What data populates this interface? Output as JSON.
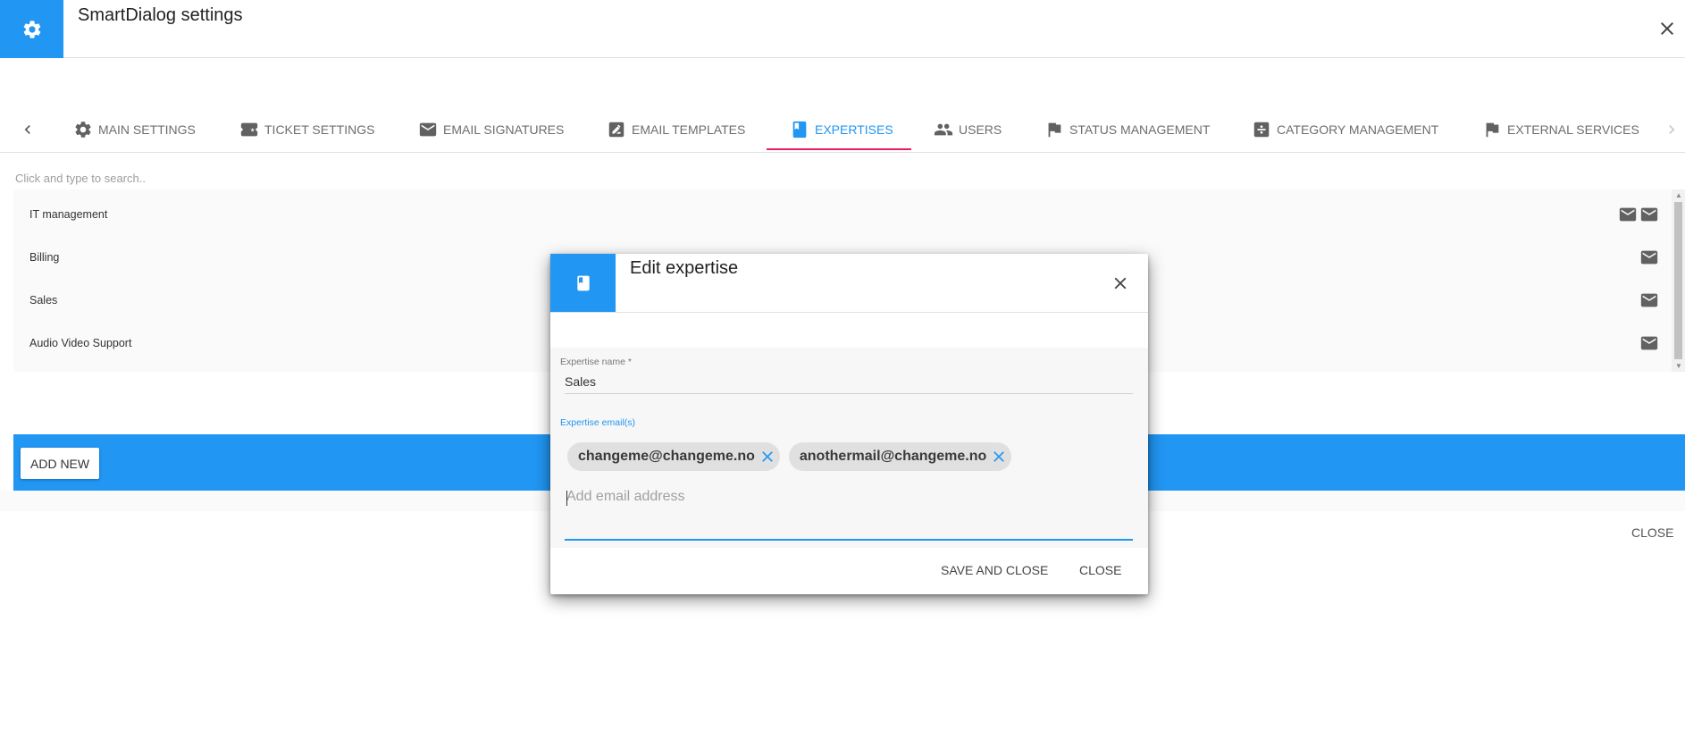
{
  "header": {
    "title": "SmartDialog settings",
    "icon": "gear-icon",
    "accent": "#2196f3"
  },
  "tabs": [
    {
      "label": "MAIN SETTINGS",
      "icon": "gear-icon",
      "active": false
    },
    {
      "label": "TICKET SETTINGS",
      "icon": "ticket-icon",
      "active": false
    },
    {
      "label": "EMAIL SIGNATURES",
      "icon": "envelope-icon",
      "active": false
    },
    {
      "label": "EMAIL TEMPLATES",
      "icon": "template-icon",
      "active": false
    },
    {
      "label": "EXPERTISES",
      "icon": "book-icon",
      "active": true
    },
    {
      "label": "USERS",
      "icon": "people-icon",
      "active": false
    },
    {
      "label": "STATUS MANAGEMENT",
      "icon": "flag-icon",
      "active": false
    },
    {
      "label": "CATEGORY MANAGEMENT",
      "icon": "category-icon",
      "active": false
    },
    {
      "label": "EXTERNAL SERVICES",
      "icon": "flag-icon",
      "active": false
    }
  ],
  "search": {
    "placeholder": "Click and type to search.."
  },
  "expertises": [
    {
      "name": "IT management",
      "mail_icon_count": 2
    },
    {
      "name": "Billing",
      "mail_icon_count": 1
    },
    {
      "name": "Sales",
      "mail_icon_count": 1
    },
    {
      "name": "Audio Video Support",
      "mail_icon_count": 1
    }
  ],
  "footer": {
    "add_new_label": "ADD NEW",
    "close_label": "CLOSE"
  },
  "dialog": {
    "title": "Edit expertise",
    "icon": "book-icon",
    "name_label": "Expertise name *",
    "name_value": "Sales",
    "emails_label": "Expertise email(s)",
    "emails": [
      "changeme@changeme.no",
      "anothermail@changeme.no"
    ],
    "email_placeholder": "Add email address",
    "save_label": "SAVE AND CLOSE",
    "close_label": "CLOSE"
  },
  "colors": {
    "primary": "#2196f3",
    "tab_indicator": "#e91e63",
    "icon_grey": "#616161"
  }
}
